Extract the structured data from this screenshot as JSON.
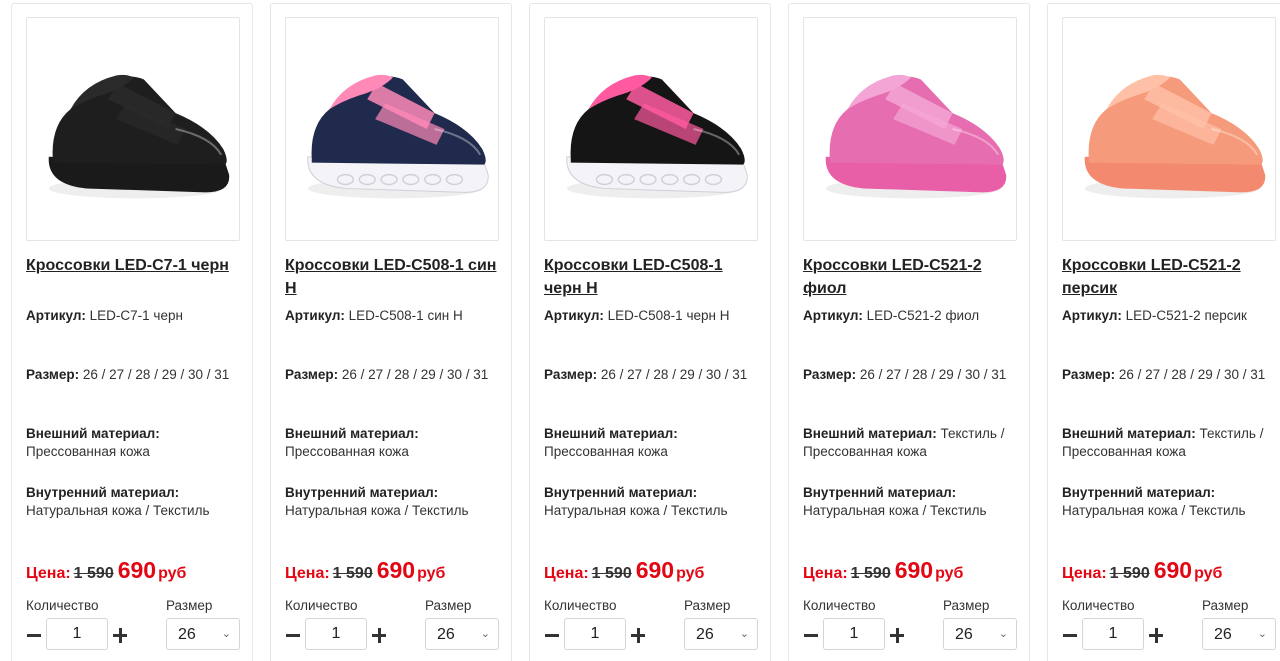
{
  "labels": {
    "article": "Артикул:",
    "size": "Размер:",
    "outer": "Внешний материал:",
    "inner": "Внутренний материал:",
    "price": "Цена:",
    "currency": "руб",
    "qty": "Количество",
    "size_select": "Размер"
  },
  "products": [
    {
      "title": "Кроссовки LED-C7-1 черн",
      "article": "LED-C7-1 черн",
      "sizes": "26 / 27 / 28 / 29 / 30 / 31",
      "outer": "Прессованная кожа",
      "inner": "Натуральная кожа / Текстиль",
      "old_price": "1 590",
      "new_price": "690",
      "qty": "1",
      "size_selected": "26",
      "image": "black-velcro-sneaker"
    },
    {
      "title": "Кроссовки LED-C508-1 син Н",
      "article": "LED-C508-1 син Н",
      "sizes": "26 / 27 / 28 / 29 / 30 / 31",
      "outer": "Прессованная кожа",
      "inner": "Натуральная кожа / Текстиль",
      "old_price": "1 590",
      "new_price": "690",
      "qty": "1",
      "size_selected": "26",
      "image": "navy-glitter-sneaker"
    },
    {
      "title": "Кроссовки LED-C508-1 черн Н",
      "article": "LED-C508-1 черн Н",
      "sizes": "26 / 27 / 28 / 29 / 30 / 31",
      "outer": "Прессованная кожа",
      "inner": "Натуральная кожа / Текстиль",
      "old_price": "1 590",
      "new_price": "690",
      "qty": "1",
      "size_selected": "26",
      "image": "black-glitter-sneaker"
    },
    {
      "title": "Кроссовки LED-C521-2 фиол",
      "article": "LED-C521-2 фиол",
      "sizes": "26 / 27 / 28 / 29 / 30 / 31",
      "outer": "Текстиль / Прессованная кожа",
      "inner": "Натуральная кожа / Текстиль",
      "old_price": "1 590",
      "new_price": "690",
      "qty": "1",
      "size_selected": "26",
      "image": "pink-sneaker"
    },
    {
      "title": "Кроссовки LED-C521-2 персик",
      "article": "LED-C521-2 персик",
      "sizes": "26 / 27 / 28 / 29 / 30 / 31",
      "outer": "Текстиль / Прессованная кожа",
      "inner": "Натуральная кожа / Текстиль",
      "old_price": "1 590",
      "new_price": "690",
      "qty": "1",
      "size_selected": "26",
      "image": "peach-sneaker"
    }
  ],
  "colors": {
    "accent_red": "#e30613",
    "buy_button": "#f5a623",
    "shoe_colors": [
      "#1e1e1e",
      "#1f2a4d",
      "#151515",
      "#e66db0",
      "#f59a7a"
    ],
    "shoe_accents": [
      "#2a2a2a",
      "#ff8ab8",
      "#ff5aa0",
      "#f3a6d6",
      "#ffc0a8"
    ],
    "sole_colors": [
      "#1a1a1a",
      "#f4f4f8",
      "#f4f4f8",
      "#e85fa8",
      "#f38a70"
    ]
  }
}
